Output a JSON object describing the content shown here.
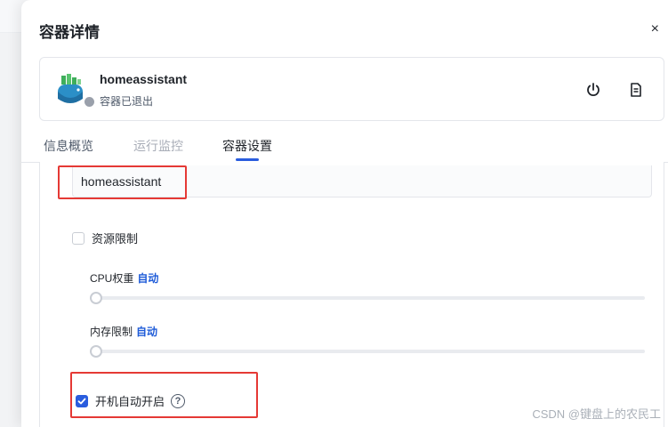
{
  "dialog": {
    "title": "容器详情",
    "close_label": "×"
  },
  "container": {
    "name": "homeassistant",
    "status": "容器已退出",
    "status_color": "#9aa0ab"
  },
  "header_actions": {
    "power_icon": "power-icon",
    "log_icon": "document-icon"
  },
  "tabs": [
    {
      "label": "信息概览",
      "state": "normal"
    },
    {
      "label": "运行监控",
      "state": "disabled"
    },
    {
      "label": "容器设置",
      "state": "active"
    }
  ],
  "settings": {
    "name_value": "homeassistant",
    "resource_limit": {
      "label": "资源限制",
      "checked": false
    },
    "cpu": {
      "label": "CPU权重",
      "value_label": "自动",
      "level": 0
    },
    "memory": {
      "label": "内存限制",
      "value_label": "自动",
      "level": 0
    },
    "autostart": {
      "label": "开机自动开启",
      "checked": true,
      "help_glyph": "?"
    }
  },
  "watermark": "CSDN @键盘上的农民工",
  "colors": {
    "accent": "#2a5dde",
    "highlight_box": "#e53935"
  }
}
